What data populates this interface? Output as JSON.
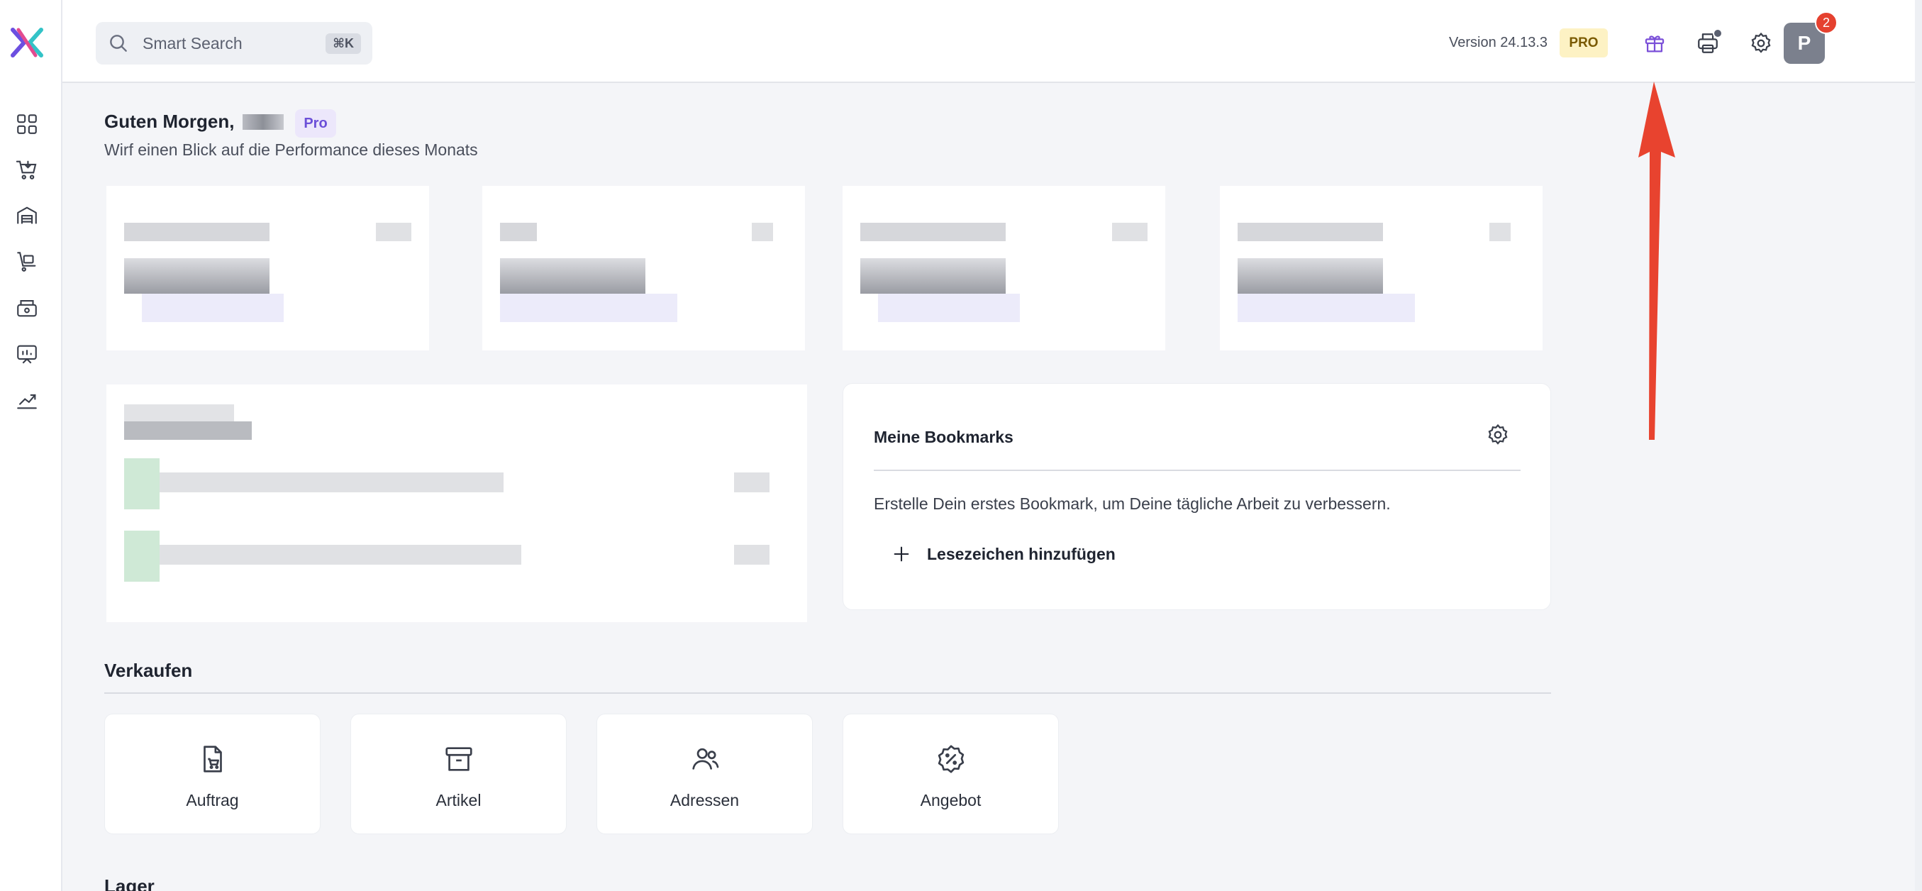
{
  "header": {
    "search_placeholder": "Smart Search",
    "search_shortcut": "⌘K",
    "version": "Version 24.13.3",
    "plan_badge": "PRO",
    "avatar_initial": "P",
    "notification_count": "2"
  },
  "sidebar": {
    "items": [
      {
        "icon": "dashboard-icon"
      },
      {
        "icon": "cart-icon"
      },
      {
        "icon": "warehouse-icon"
      },
      {
        "icon": "trolley-icon"
      },
      {
        "icon": "cash-register-icon"
      },
      {
        "icon": "presentation-icon"
      },
      {
        "icon": "analytics-icon"
      }
    ]
  },
  "greeting": {
    "title": "Guten Morgen,",
    "plan_pill": "Pro",
    "subtitle": "Wirf einen Blick auf die Performance dieses Monats"
  },
  "bookmarks": {
    "title": "Meine Bookmarks",
    "empty_text": "Erstelle Dein erstes Bookmark, um Deine tägliche Arbeit zu verbessern.",
    "add_label": "Lesezeichen hinzufügen"
  },
  "sections": {
    "sell": {
      "title": "Verkaufen",
      "tiles": [
        {
          "label": "Auftrag",
          "icon": "order-icon"
        },
        {
          "label": "Artikel",
          "icon": "archive-icon"
        },
        {
          "label": "Adressen",
          "icon": "contacts-icon"
        },
        {
          "label": "Angebot",
          "icon": "discount-badge-icon"
        }
      ]
    },
    "stock": {
      "title": "Lager"
    }
  },
  "colors": {
    "accent_pro": "#6b4fd8",
    "badge_yellow": "#fdf2c4",
    "notification_red": "#e5412f",
    "annotation_arrow": "#e8432f"
  }
}
